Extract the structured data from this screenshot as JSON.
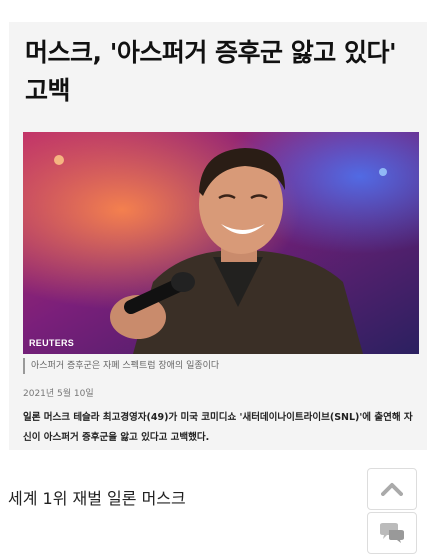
{
  "article": {
    "headline": "머스크, '아스퍼거 증후군 앓고 있다' 고백",
    "photo_credit": "REUTERS",
    "caption": "아스퍼거 증후군은 자폐 스펙트럼 장애의 일종이다",
    "date": "2021년 5월 10일",
    "body": "일론 머스크 테슬라 최고경영자(49)가 미국 코미디쇼 '새터데이나이트라이브(SNL)'에 출연해 자신이 아스퍼거 증후군을 앓고 있다고 고백했다."
  },
  "footer": {
    "text": "세계 1위 재벌 일론 머스크"
  },
  "icons": {
    "scroll_top": "chevron-up-icon",
    "comments": "speech-bubbles-icon"
  }
}
